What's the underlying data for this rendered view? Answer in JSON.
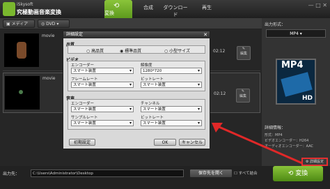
{
  "header": {
    "brand_small": "iSkysoft",
    "brand_title": "究極動画音楽変換",
    "tabs": [
      "変換",
      "合成",
      "ダウンロード",
      "再生"
    ]
  },
  "toolbar": {
    "media": "メディア",
    "dvd": "DVD"
  },
  "list": {
    "rows": [
      {
        "name": "movie",
        "time": "02:12",
        "edit": "編集"
      },
      {
        "name": "movie",
        "time": "02:12",
        "edit": "編集"
      }
    ]
  },
  "right": {
    "format_label": "出力形式：",
    "format_value": "MP4",
    "mp4": "MP4",
    "hd": "HD",
    "detail_label": "詳細情報：",
    "details": [
      "形式：MP4",
      "ビデオエンコーダー：H264",
      "オーディオエンコーダー：AAC"
    ],
    "settings_btn": "詳細設定"
  },
  "bottom": {
    "out_label": "出力先：",
    "out_path": "C:\\Users\\Administrator\\Desktop",
    "open_btn": "保存先を開く",
    "merge": "すべて結合",
    "convert": "変換"
  },
  "dialog": {
    "title": "詳細設定",
    "quality_label": "品質",
    "quality_options": [
      "高品質",
      "標準品質",
      "小型サイズ"
    ],
    "video_label": "ビデオ",
    "encoder_label": "エンコーダー",
    "encoder_value": "スマート装置",
    "resolution_label": "解像度",
    "resolution_value": "1280*720",
    "framerate_label": "フレームレート",
    "framerate_value": "スマート装置",
    "bitrate_label": "ビットレート",
    "bitrate_value": "スマート装置",
    "audio_label": "音声",
    "a_encoder_label": "エンコーダー",
    "a_encoder_value": "スマート装置",
    "channel_label": "チャンネル",
    "channel_value": "スマート装置",
    "samplerate_label": "サンプルレート",
    "samplerate_value": "スマート装置",
    "a_bitrate_label": "ビットレート",
    "a_bitrate_value": "スマート装置",
    "reset": "初期設定",
    "ok": "OK",
    "cancel": "キャンセル"
  }
}
